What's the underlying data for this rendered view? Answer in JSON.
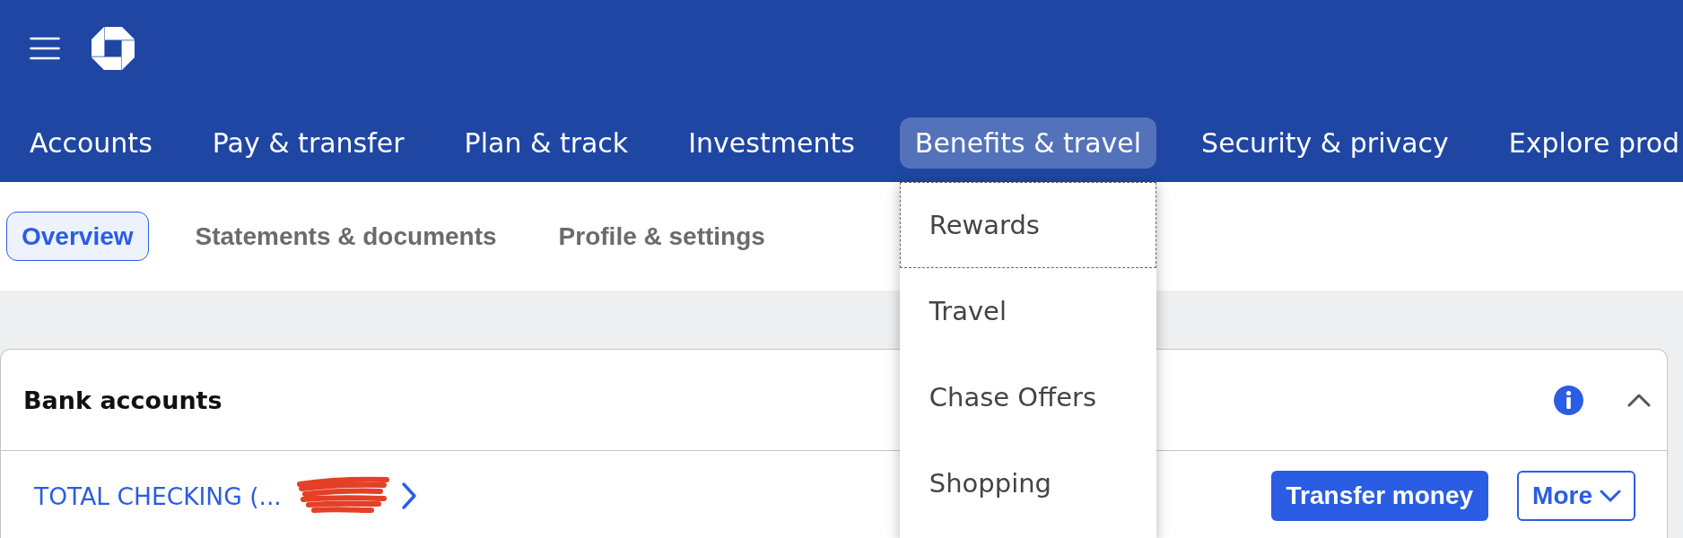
{
  "nav": [
    {
      "label": "Accounts",
      "selected": false
    },
    {
      "label": "Pay & transfer",
      "selected": false
    },
    {
      "label": "Plan & track",
      "selected": false
    },
    {
      "label": "Investments",
      "selected": false
    },
    {
      "label": "Benefits & travel",
      "selected": true
    },
    {
      "label": "Security & privacy",
      "selected": false
    },
    {
      "label": "Explore prod",
      "selected": false
    }
  ],
  "nav_menu": [
    {
      "label": "Rewards",
      "focused": true
    },
    {
      "label": "Travel",
      "focused": false
    },
    {
      "label": "Chase Offers",
      "focused": false
    },
    {
      "label": "Shopping",
      "focused": false
    }
  ],
  "subnav": [
    {
      "label": "Overview",
      "selected": true
    },
    {
      "label": "Statements & documents",
      "selected": false
    },
    {
      "label": "Profile & settings",
      "selected": false
    }
  ],
  "bank_accounts": {
    "title": "Bank accounts",
    "expanded": true,
    "accounts": [
      {
        "name": "TOTAL CHECKING (...",
        "redacted": true,
        "actions": [
          {
            "label": "Transfer money",
            "kind": "primary"
          },
          {
            "label": "More",
            "kind": "menu"
          }
        ]
      }
    ]
  }
}
